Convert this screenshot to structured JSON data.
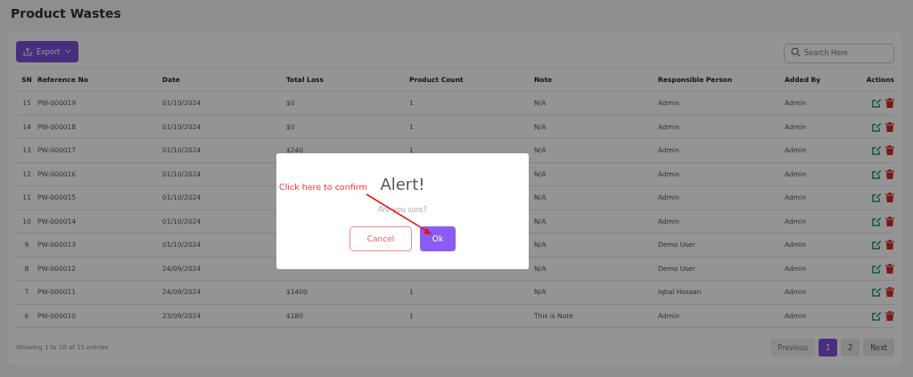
{
  "page": {
    "title": "Product Wastes"
  },
  "toolbar": {
    "export_button": "Export",
    "search": {
      "placeholder": "Search Here"
    }
  },
  "table": {
    "columns": [
      "SN",
      "Reference No",
      "Date",
      "Total Loss",
      "Product Count",
      "Note",
      "Responsible Person",
      "Added By",
      "Actions"
    ],
    "rows": [
      {
        "sn": "15",
        "reference_no": "PW-000019",
        "date": "01/10/2024",
        "total_loss": "$0",
        "product_count": "1",
        "note": "N/A",
        "responsible_person": "Admin",
        "added_by": "Admin"
      },
      {
        "sn": "14",
        "reference_no": "PW-000018",
        "date": "01/10/2024",
        "total_loss": "$0",
        "product_count": "1",
        "note": "N/A",
        "responsible_person": "Admin",
        "added_by": "Admin"
      },
      {
        "sn": "13",
        "reference_no": "PW-000017",
        "date": "01/10/2024",
        "total_loss": "$240",
        "product_count": "1",
        "note": "N/A",
        "responsible_person": "Admin",
        "added_by": "Admin"
      },
      {
        "sn": "12",
        "reference_no": "PW-000016",
        "date": "01/10/2024",
        "note": "N/A",
        "responsible_person": "Admin",
        "added_by": "Admin"
      },
      {
        "sn": "11",
        "reference_no": "PW-000015",
        "date": "01/10/2024",
        "note": "N/A",
        "responsible_person": "Admin",
        "added_by": "Admin"
      },
      {
        "sn": "10",
        "reference_no": "PW-000014",
        "date": "01/10/2024",
        "note": "N/A",
        "responsible_person": "Admin",
        "added_by": "Admin"
      },
      {
        "sn": "9",
        "reference_no": "PW-000013",
        "date": "01/10/2024",
        "note": "N/A",
        "responsible_person": "Demo User",
        "added_by": "Admin"
      },
      {
        "sn": "8",
        "reference_no": "PW-000012",
        "date": "24/09/2024",
        "note": "N/A",
        "responsible_person": "Demo User",
        "added_by": "Admin"
      },
      {
        "sn": "7",
        "reference_no": "PW-000011",
        "date": "24/09/2024",
        "total_loss": "$1400",
        "product_count": "1",
        "note": "N/A",
        "responsible_person": "Iqbal Hossan",
        "added_by": "Admin"
      },
      {
        "sn": "6",
        "reference_no": "PW-000010",
        "date": "23/09/2024",
        "total_loss": "$180",
        "product_count": "1",
        "note": "This is Note",
        "responsible_person": "Admin",
        "added_by": "Admin"
      }
    ]
  },
  "footer": {
    "entries_info": "Showing 1 to 10 of 15 entries",
    "pagination": [
      {
        "label": "Previous",
        "selected": false,
        "disabled": true
      },
      {
        "label": "1",
        "selected": true
      },
      {
        "label": "2",
        "selected": false
      },
      {
        "label": "Next",
        "selected": false,
        "disabled": false
      }
    ]
  },
  "dialog": {
    "title": "Alert!",
    "message": "Are you sure?",
    "cancel_button": "Cancel",
    "ok_button": "Ok",
    "annotation": "Click here to confirm"
  }
}
